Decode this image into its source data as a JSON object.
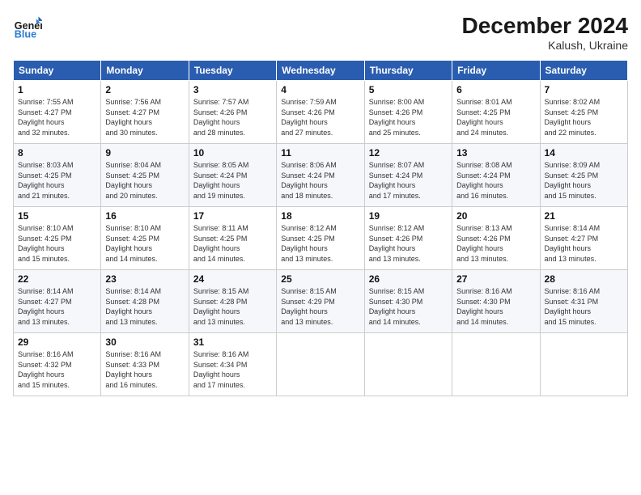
{
  "header": {
    "logo_line1": "General",
    "logo_line2": "Blue",
    "month": "December 2024",
    "location": "Kalush, Ukraine"
  },
  "weekdays": [
    "Sunday",
    "Monday",
    "Tuesday",
    "Wednesday",
    "Thursday",
    "Friday",
    "Saturday"
  ],
  "weeks": [
    [
      {
        "day": "1",
        "sunrise": "7:55 AM",
        "sunset": "4:27 PM",
        "daylight": "8 hours and 32 minutes."
      },
      {
        "day": "2",
        "sunrise": "7:56 AM",
        "sunset": "4:27 PM",
        "daylight": "8 hours and 30 minutes."
      },
      {
        "day": "3",
        "sunrise": "7:57 AM",
        "sunset": "4:26 PM",
        "daylight": "8 hours and 28 minutes."
      },
      {
        "day": "4",
        "sunrise": "7:59 AM",
        "sunset": "4:26 PM",
        "daylight": "8 hours and 27 minutes."
      },
      {
        "day": "5",
        "sunrise": "8:00 AM",
        "sunset": "4:26 PM",
        "daylight": "8 hours and 25 minutes."
      },
      {
        "day": "6",
        "sunrise": "8:01 AM",
        "sunset": "4:25 PM",
        "daylight": "8 hours and 24 minutes."
      },
      {
        "day": "7",
        "sunrise": "8:02 AM",
        "sunset": "4:25 PM",
        "daylight": "8 hours and 22 minutes."
      }
    ],
    [
      {
        "day": "8",
        "sunrise": "8:03 AM",
        "sunset": "4:25 PM",
        "daylight": "8 hours and 21 minutes."
      },
      {
        "day": "9",
        "sunrise": "8:04 AM",
        "sunset": "4:25 PM",
        "daylight": "8 hours and 20 minutes."
      },
      {
        "day": "10",
        "sunrise": "8:05 AM",
        "sunset": "4:24 PM",
        "daylight": "8 hours and 19 minutes."
      },
      {
        "day": "11",
        "sunrise": "8:06 AM",
        "sunset": "4:24 PM",
        "daylight": "8 hours and 18 minutes."
      },
      {
        "day": "12",
        "sunrise": "8:07 AM",
        "sunset": "4:24 PM",
        "daylight": "8 hours and 17 minutes."
      },
      {
        "day": "13",
        "sunrise": "8:08 AM",
        "sunset": "4:24 PM",
        "daylight": "8 hours and 16 minutes."
      },
      {
        "day": "14",
        "sunrise": "8:09 AM",
        "sunset": "4:25 PM",
        "daylight": "8 hours and 15 minutes."
      }
    ],
    [
      {
        "day": "15",
        "sunrise": "8:10 AM",
        "sunset": "4:25 PM",
        "daylight": "8 hours and 15 minutes."
      },
      {
        "day": "16",
        "sunrise": "8:10 AM",
        "sunset": "4:25 PM",
        "daylight": "8 hours and 14 minutes."
      },
      {
        "day": "17",
        "sunrise": "8:11 AM",
        "sunset": "4:25 PM",
        "daylight": "8 hours and 14 minutes."
      },
      {
        "day": "18",
        "sunrise": "8:12 AM",
        "sunset": "4:25 PM",
        "daylight": "8 hours and 13 minutes."
      },
      {
        "day": "19",
        "sunrise": "8:12 AM",
        "sunset": "4:26 PM",
        "daylight": "8 hours and 13 minutes."
      },
      {
        "day": "20",
        "sunrise": "8:13 AM",
        "sunset": "4:26 PM",
        "daylight": "8 hours and 13 minutes."
      },
      {
        "day": "21",
        "sunrise": "8:14 AM",
        "sunset": "4:27 PM",
        "daylight": "8 hours and 13 minutes."
      }
    ],
    [
      {
        "day": "22",
        "sunrise": "8:14 AM",
        "sunset": "4:27 PM",
        "daylight": "8 hours and 13 minutes."
      },
      {
        "day": "23",
        "sunrise": "8:14 AM",
        "sunset": "4:28 PM",
        "daylight": "8 hours and 13 minutes."
      },
      {
        "day": "24",
        "sunrise": "8:15 AM",
        "sunset": "4:28 PM",
        "daylight": "8 hours and 13 minutes."
      },
      {
        "day": "25",
        "sunrise": "8:15 AM",
        "sunset": "4:29 PM",
        "daylight": "8 hours and 13 minutes."
      },
      {
        "day": "26",
        "sunrise": "8:15 AM",
        "sunset": "4:30 PM",
        "daylight": "8 hours and 14 minutes."
      },
      {
        "day": "27",
        "sunrise": "8:16 AM",
        "sunset": "4:30 PM",
        "daylight": "8 hours and 14 minutes."
      },
      {
        "day": "28",
        "sunrise": "8:16 AM",
        "sunset": "4:31 PM",
        "daylight": "8 hours and 15 minutes."
      }
    ],
    [
      {
        "day": "29",
        "sunrise": "8:16 AM",
        "sunset": "4:32 PM",
        "daylight": "8 hours and 15 minutes."
      },
      {
        "day": "30",
        "sunrise": "8:16 AM",
        "sunset": "4:33 PM",
        "daylight": "8 hours and 16 minutes."
      },
      {
        "day": "31",
        "sunrise": "8:16 AM",
        "sunset": "4:34 PM",
        "daylight": "8 hours and 17 minutes."
      },
      null,
      null,
      null,
      null
    ]
  ]
}
